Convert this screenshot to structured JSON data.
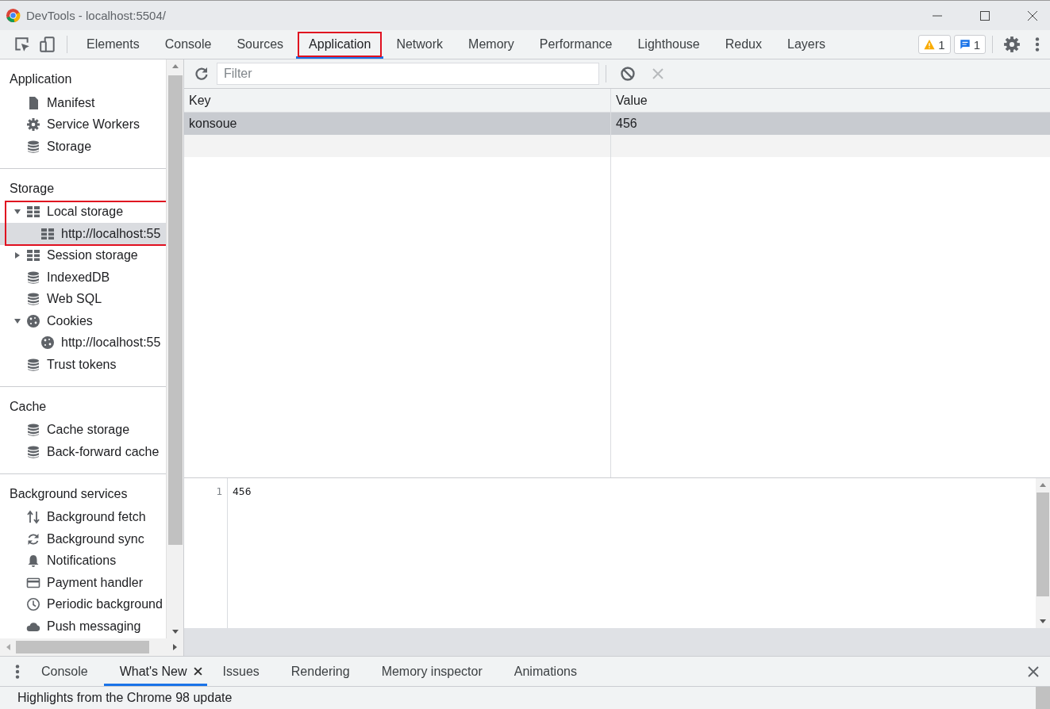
{
  "window": {
    "title": "DevTools - localhost:5504/"
  },
  "tabs": [
    {
      "label": "Elements",
      "selected": false,
      "highlighted": false
    },
    {
      "label": "Console",
      "selected": false,
      "highlighted": false
    },
    {
      "label": "Sources",
      "selected": false,
      "highlighted": false
    },
    {
      "label": "Application",
      "selected": true,
      "highlighted": true
    },
    {
      "label": "Network",
      "selected": false,
      "highlighted": false
    },
    {
      "label": "Memory",
      "selected": false,
      "highlighted": false
    },
    {
      "label": "Performance",
      "selected": false,
      "highlighted": false
    },
    {
      "label": "Lighthouse",
      "selected": false,
      "highlighted": false
    },
    {
      "label": "Redux",
      "selected": false,
      "highlighted": false
    },
    {
      "label": "Layers",
      "selected": false,
      "highlighted": false
    }
  ],
  "badges": [
    {
      "kind": "warning",
      "count": "1"
    },
    {
      "kind": "message",
      "count": "1"
    }
  ],
  "sidebar": {
    "sections": [
      {
        "title": "Application",
        "items": [
          {
            "label": "Manifest",
            "kind": "file",
            "selected": false
          },
          {
            "label": "Service Workers",
            "kind": "gear",
            "selected": false
          },
          {
            "label": "Storage",
            "kind": "database",
            "selected": false
          }
        ]
      },
      {
        "title": "Storage",
        "items": [
          {
            "label": "Local storage",
            "kind": "grid",
            "selected": false,
            "expanded": true,
            "highlighted": true,
            "children": [
              {
                "label": "http://localhost:55",
                "kind": "grid",
                "selected": true
              }
            ]
          },
          {
            "label": "Session storage",
            "kind": "grid",
            "selected": false,
            "expanded": false
          },
          {
            "label": "IndexedDB",
            "kind": "database",
            "selected": false
          },
          {
            "label": "Web SQL",
            "kind": "database",
            "selected": false
          },
          {
            "label": "Cookies",
            "kind": "cookie",
            "selected": false,
            "expanded": true,
            "children": [
              {
                "label": "http://localhost:55",
                "kind": "cookie",
                "selected": false
              }
            ]
          },
          {
            "label": "Trust tokens",
            "kind": "database",
            "selected": false
          }
        ]
      },
      {
        "title": "Cache",
        "items": [
          {
            "label": "Cache storage",
            "kind": "database",
            "selected": false
          },
          {
            "label": "Back-forward cache",
            "kind": "database",
            "selected": false
          }
        ]
      },
      {
        "title": "Background services",
        "items": [
          {
            "label": "Background fetch",
            "kind": "updown",
            "selected": false
          },
          {
            "label": "Background sync",
            "kind": "sync",
            "selected": false
          },
          {
            "label": "Notifications",
            "kind": "bell",
            "selected": false
          },
          {
            "label": "Payment handler",
            "kind": "card",
            "selected": false
          },
          {
            "label": "Periodic background",
            "kind": "clock",
            "selected": false
          },
          {
            "label": "Push messaging",
            "kind": "cloud",
            "selected": false
          }
        ]
      }
    ]
  },
  "filter": {
    "placeholder": "Filter"
  },
  "table": {
    "columns": [
      "Key",
      "Value"
    ],
    "rows": [
      {
        "cells": [
          "konsoue",
          "456"
        ],
        "selected": true
      }
    ]
  },
  "preview": {
    "lines": [
      {
        "number": "1",
        "text": "456"
      }
    ]
  },
  "drawer": {
    "tabs": [
      {
        "label": "Console",
        "selected": false,
        "closable": false
      },
      {
        "label": "What's New",
        "selected": true,
        "closable": true
      },
      {
        "label": "Issues",
        "selected": false,
        "closable": false
      },
      {
        "label": "Rendering",
        "selected": false,
        "closable": false
      },
      {
        "label": "Memory inspector",
        "selected": false,
        "closable": false
      },
      {
        "label": "Animations",
        "selected": false,
        "closable": false
      }
    ],
    "content": "Highlights from the Chrome 98 update"
  }
}
